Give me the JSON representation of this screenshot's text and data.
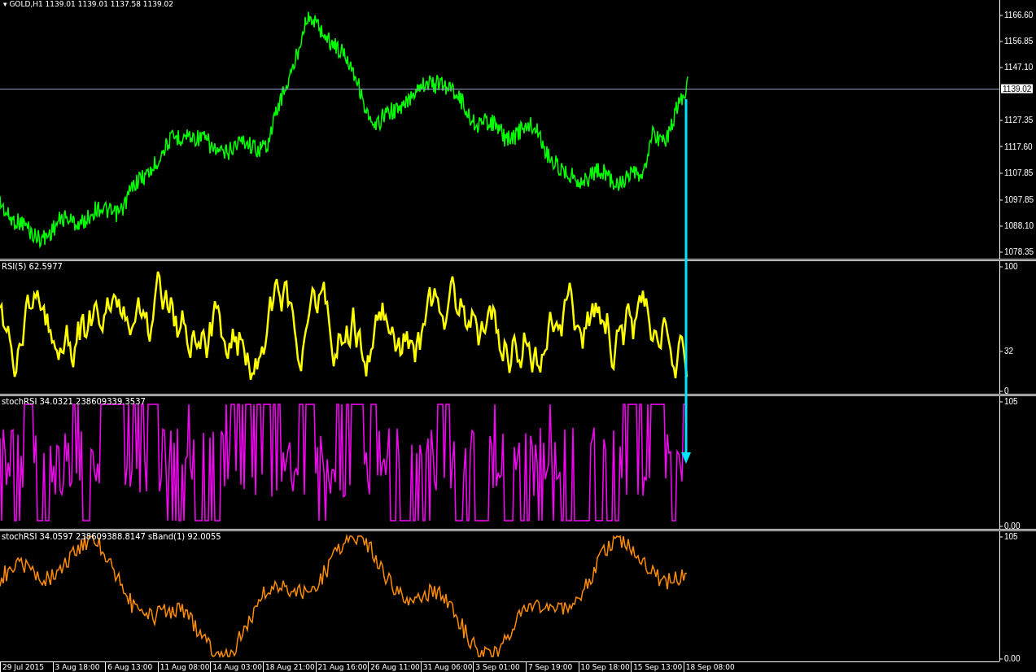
{
  "header": "▾ GOLD,H1 1139.01 1139.01 1137.58 1139.02",
  "price_marker": "1139.02",
  "panes": [
    {
      "kind": "price",
      "color": "#00ff00",
      "ticks": [
        "1166.60",
        "1156.85",
        "1147.10",
        "1127.35",
        "1117.60",
        "1107.85",
        "1097.85",
        "1088.10",
        "1078.35"
      ]
    },
    {
      "kind": "rsi",
      "label": "RSI(5) 62.5977",
      "color": "#ffff00",
      "ticks": [
        "100",
        "32",
        "0"
      ]
    },
    {
      "kind": "stoch",
      "label": "stochRSI 34.0321 238609339.3537",
      "color": "#ff00ff",
      "ticks": [
        "105",
        "0.00"
      ]
    },
    {
      "kind": "bands",
      "label": "stochRSI 34.0597 238609388.8147 sBand(1) 92.0055",
      "color": "#ff8c00",
      "ticks": [
        "105",
        "0.00"
      ]
    }
  ],
  "time_axis": [
    "29 Jul 2015",
    "3 Aug 18:00",
    "6 Aug 13:00",
    "11 Aug 08:00",
    "14 Aug 03:00",
    "18 Aug 21:00",
    "21 Aug 16:00",
    "26 Aug 11:00",
    "31 Aug 06:00",
    "3 Sep 01:00",
    "7 Sep 19:00",
    "10 Sep 18:00",
    "15 Sep 13:00",
    "18 Sep 08:00"
  ]
}
